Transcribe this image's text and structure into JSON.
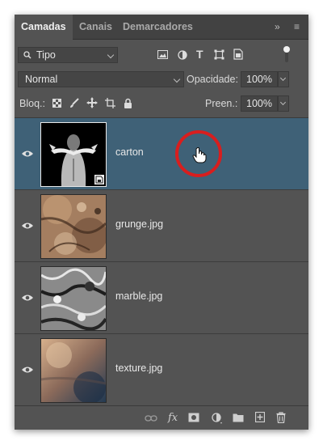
{
  "tabs": [
    {
      "label": "Camadas",
      "active": true
    },
    {
      "label": "Canais",
      "active": false
    },
    {
      "label": "Demarcadores",
      "active": false
    }
  ],
  "tab_menu": {
    "collapse_glyph": "»",
    "menu_glyph": "≡"
  },
  "filter": {
    "value": "Tipo",
    "icons": [
      "image-filter-icon",
      "adjustment-filter-icon",
      "type-filter-icon",
      "shape-filter-icon",
      "smart-object-filter-icon",
      "filter-toggle-icon"
    ],
    "type_glyph": "T"
  },
  "blend": {
    "mode": "Normal",
    "opacity_label": "Opacidade:",
    "opacity_value": "100%"
  },
  "lock": {
    "label": "Bloq.:",
    "fill_label": "Preen.:",
    "fill_value": "100%"
  },
  "layers": [
    {
      "name": "carton",
      "selected": true,
      "smart_object": true
    },
    {
      "name": "grunge.jpg",
      "selected": false
    },
    {
      "name": "marble.jpg",
      "selected": false
    },
    {
      "name": "texture.jpg",
      "selected": false
    }
  ],
  "footer_icons": [
    "link-layers-icon",
    "fx-icon",
    "add-mask-icon",
    "adjustment-layer-icon",
    "new-group-icon",
    "new-layer-icon",
    "delete-layer-icon"
  ],
  "footer_fx_label": "fx",
  "colors": {
    "panel": "#535353",
    "selected_row": "#3f6177",
    "highlight_circle": "#d81e1e"
  }
}
